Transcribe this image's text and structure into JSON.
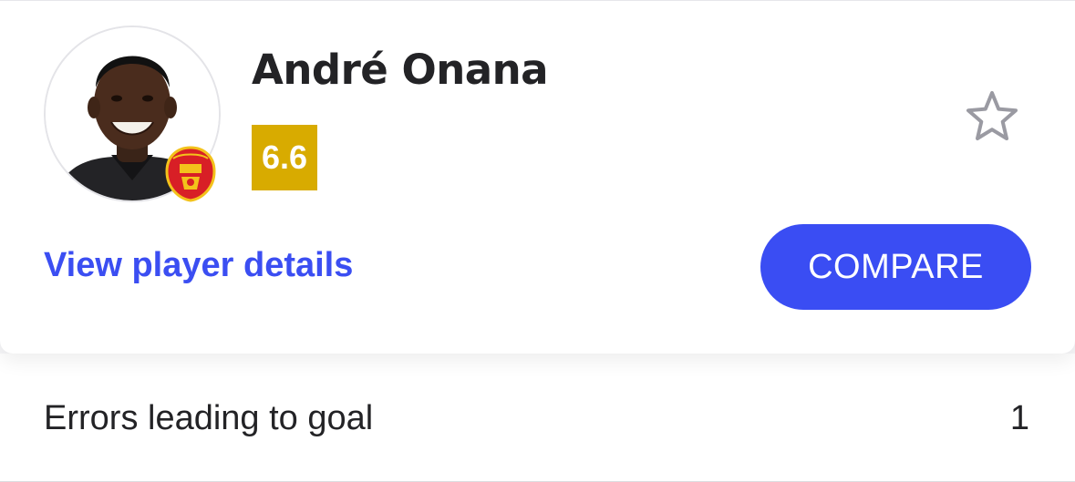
{
  "player": {
    "name": "André Onana",
    "rating": "6.6",
    "photo_icon": "player-photo",
    "club_icon": "manchester-united-crest"
  },
  "actions": {
    "favorite_icon": "star-outline-icon",
    "details_link": "View player details",
    "compare_button": "COMPARE"
  },
  "stats": [
    {
      "label": "Errors leading to goal",
      "value": "1"
    }
  ],
  "colors": {
    "accent": "#3a4df3",
    "rating_badge": "#d8ab00",
    "text": "#232326",
    "star_outline": "#9a9aa2"
  }
}
